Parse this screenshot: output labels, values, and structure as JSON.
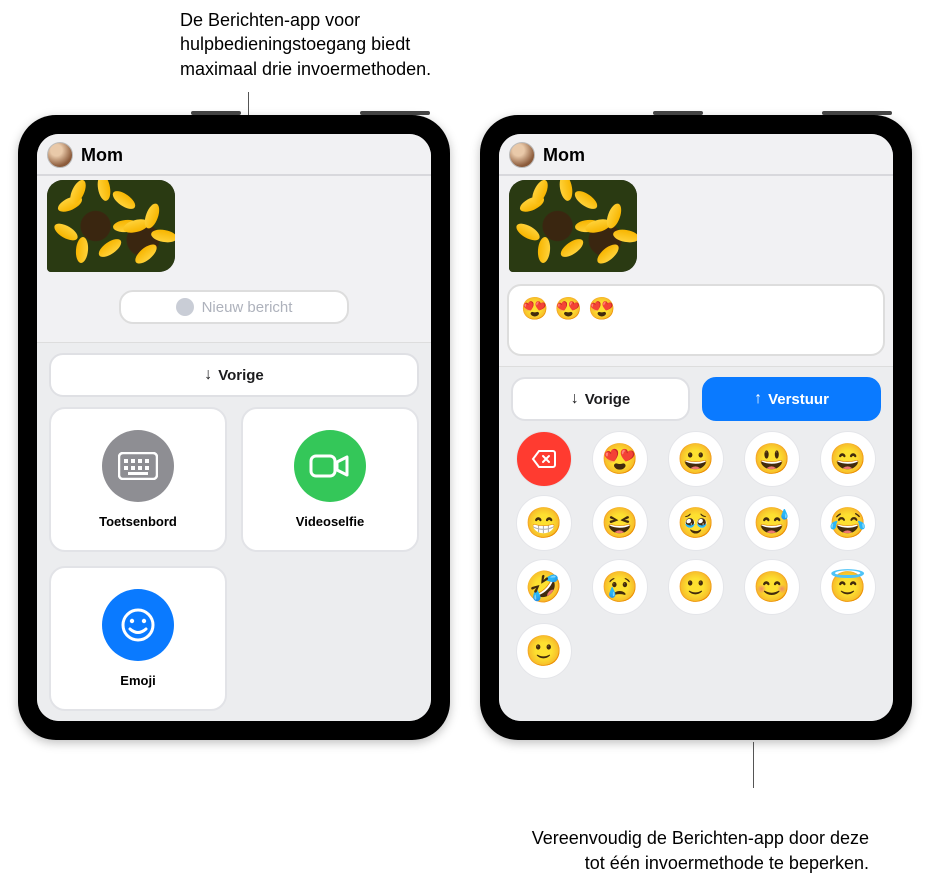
{
  "callouts": {
    "top": "De Berichten-app voor hulpbedieningstoegang biedt maximaal drie invoermethoden.",
    "bottom": "Vereenvoudig de Berichten-app door deze tot één invoermethode te beperken."
  },
  "left": {
    "contact": "Mom",
    "new_message_placeholder": "Nieuw bericht",
    "previous": "Vorige",
    "methods": {
      "keyboard": "Toetsenbord",
      "videoselfie": "Videoselfie",
      "emoji": "Emoji"
    }
  },
  "right": {
    "contact": "Mom",
    "compose_value": "😍 😍 😍",
    "previous": "Vorige",
    "send": "Verstuur",
    "emoji_keys": [
      "⌫",
      "😍",
      "😀",
      "😃",
      "😄",
      "😁",
      "😆",
      "🥹",
      "😅",
      "😂",
      "🤣",
      "😢",
      "🙂",
      "😊",
      "😇",
      "🙂"
    ]
  }
}
